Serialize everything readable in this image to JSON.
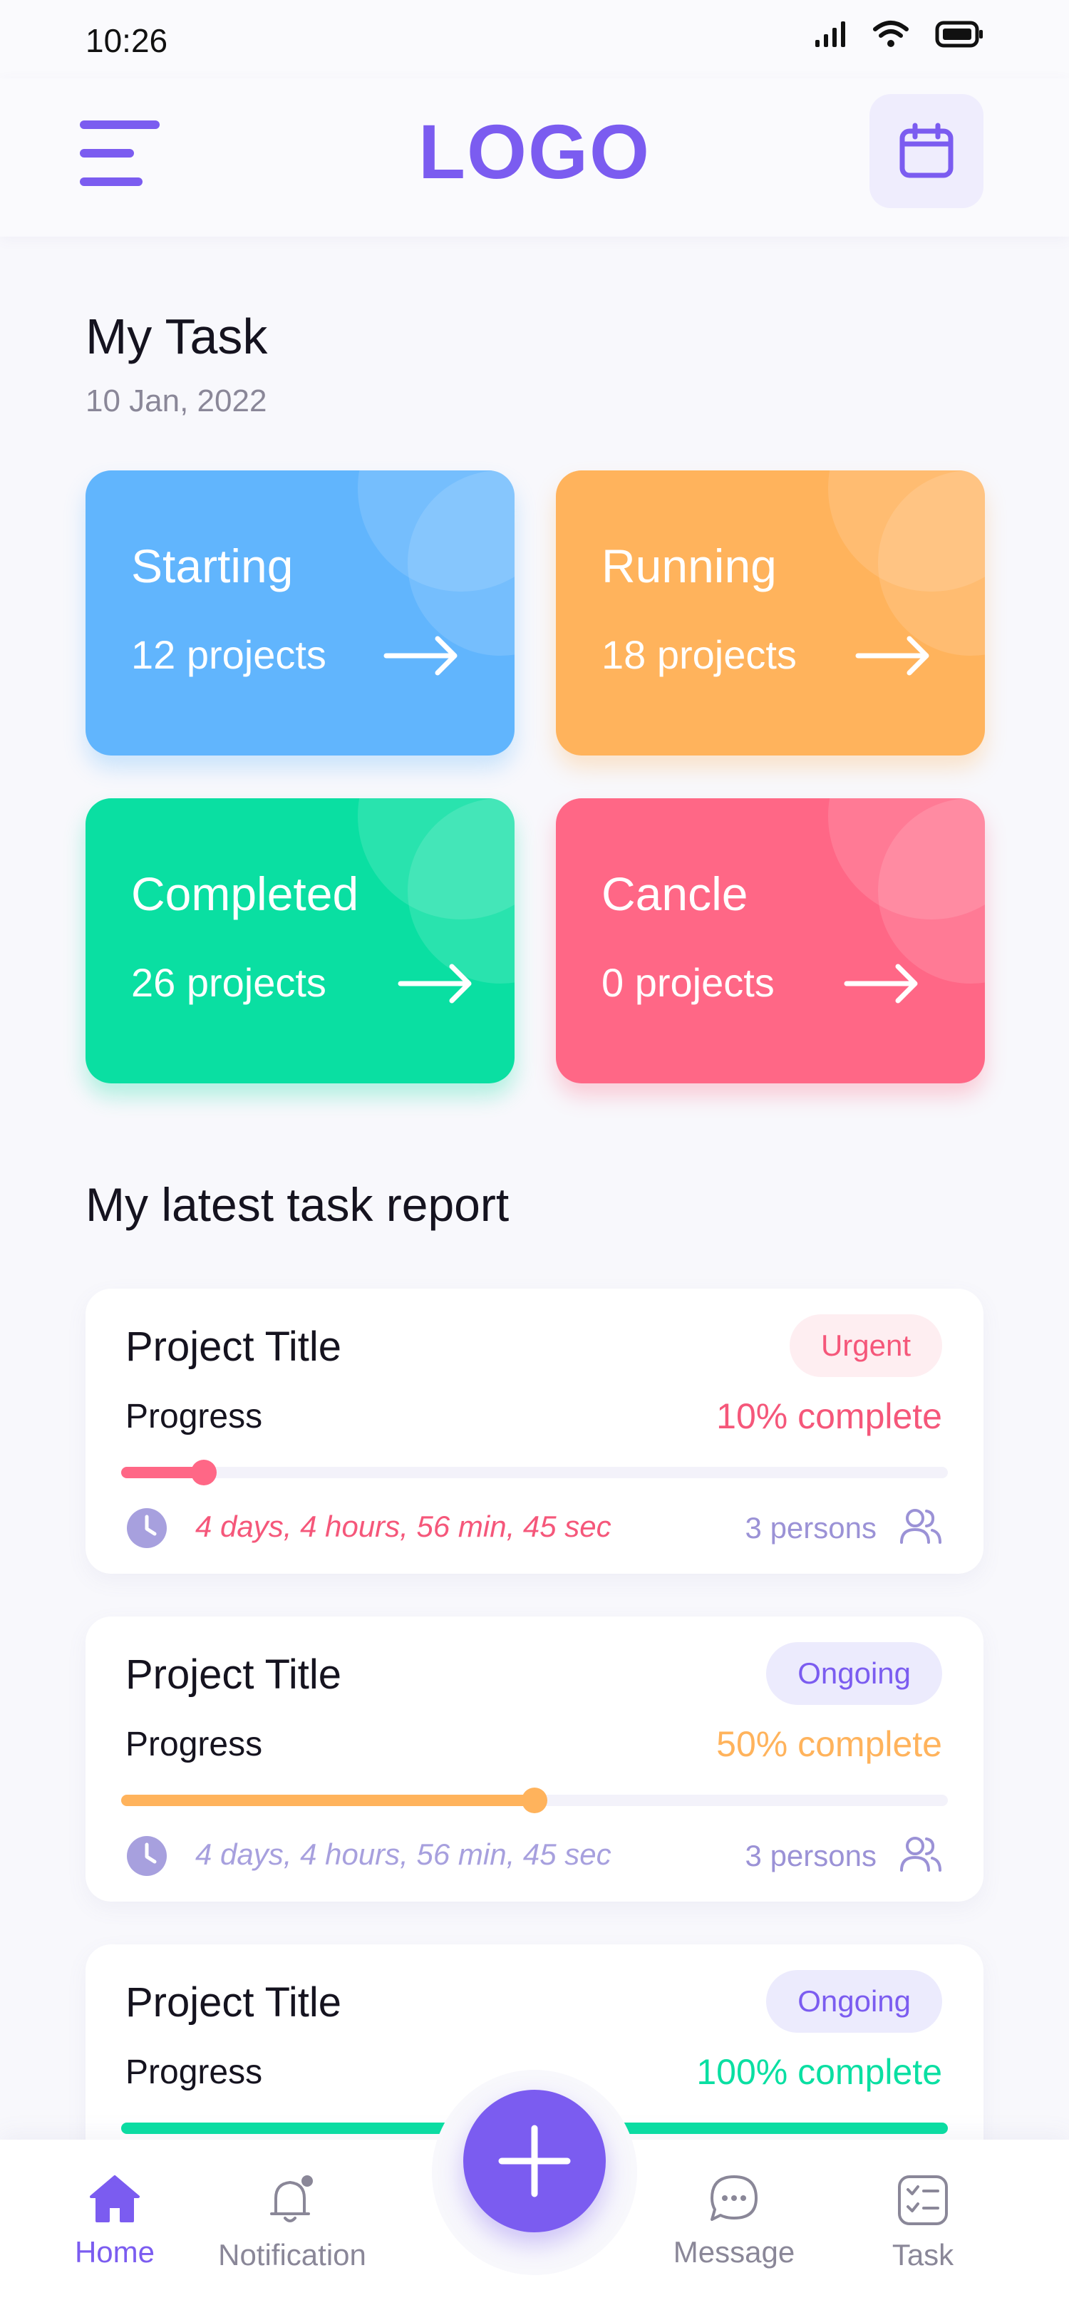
{
  "status_bar": {
    "time": "10:26"
  },
  "header": {
    "logo": "LOGO"
  },
  "page": {
    "title": "My Task",
    "date": "10 Jan, 2022"
  },
  "tiles": [
    {
      "label": "Starting",
      "count": "12 projects",
      "color": "#61b5fd"
    },
    {
      "label": "Running",
      "count": "18 projects",
      "color": "#ffb35c"
    },
    {
      "label": "Completed",
      "count": "26 projects",
      "color": "#0adfa2"
    },
    {
      "label": "Cancle",
      "count": "0 projects",
      "color": "#ff6786"
    }
  ],
  "report": {
    "title": "My latest task report",
    "cards": [
      {
        "title": "Project Title",
        "badge": "Urgent",
        "progress_label": "Progress",
        "progress_text": "10% complete",
        "progress": 0.1,
        "timer": "4 days, 4 hours, 56 min, 45 sec",
        "persons": "3 persons",
        "accent": "#ff6786"
      },
      {
        "title": "Project Title",
        "badge": "Ongoing",
        "progress_label": "Progress",
        "progress_text": "50% complete",
        "progress": 0.5,
        "timer": "4 days, 4 hours, 56 min, 45 sec",
        "persons": "3 persons",
        "accent": "#ffb35c"
      },
      {
        "title": "Project Title",
        "badge": "Ongoing",
        "progress_label": "Progress",
        "progress_text": "100% complete",
        "progress": 1.0,
        "accent": "#0adfa2"
      }
    ]
  },
  "bottom_nav": [
    {
      "label": "Home",
      "icon": "home-icon",
      "active": true
    },
    {
      "label": "Notification",
      "icon": "bell-icon",
      "active": false
    },
    {
      "label": "Message",
      "icon": "chat-icon",
      "active": false
    },
    {
      "label": "Task",
      "icon": "task-icon",
      "active": false
    }
  ],
  "colors": {
    "primary": "#7b5cf0",
    "urgent": "#f5577a"
  }
}
